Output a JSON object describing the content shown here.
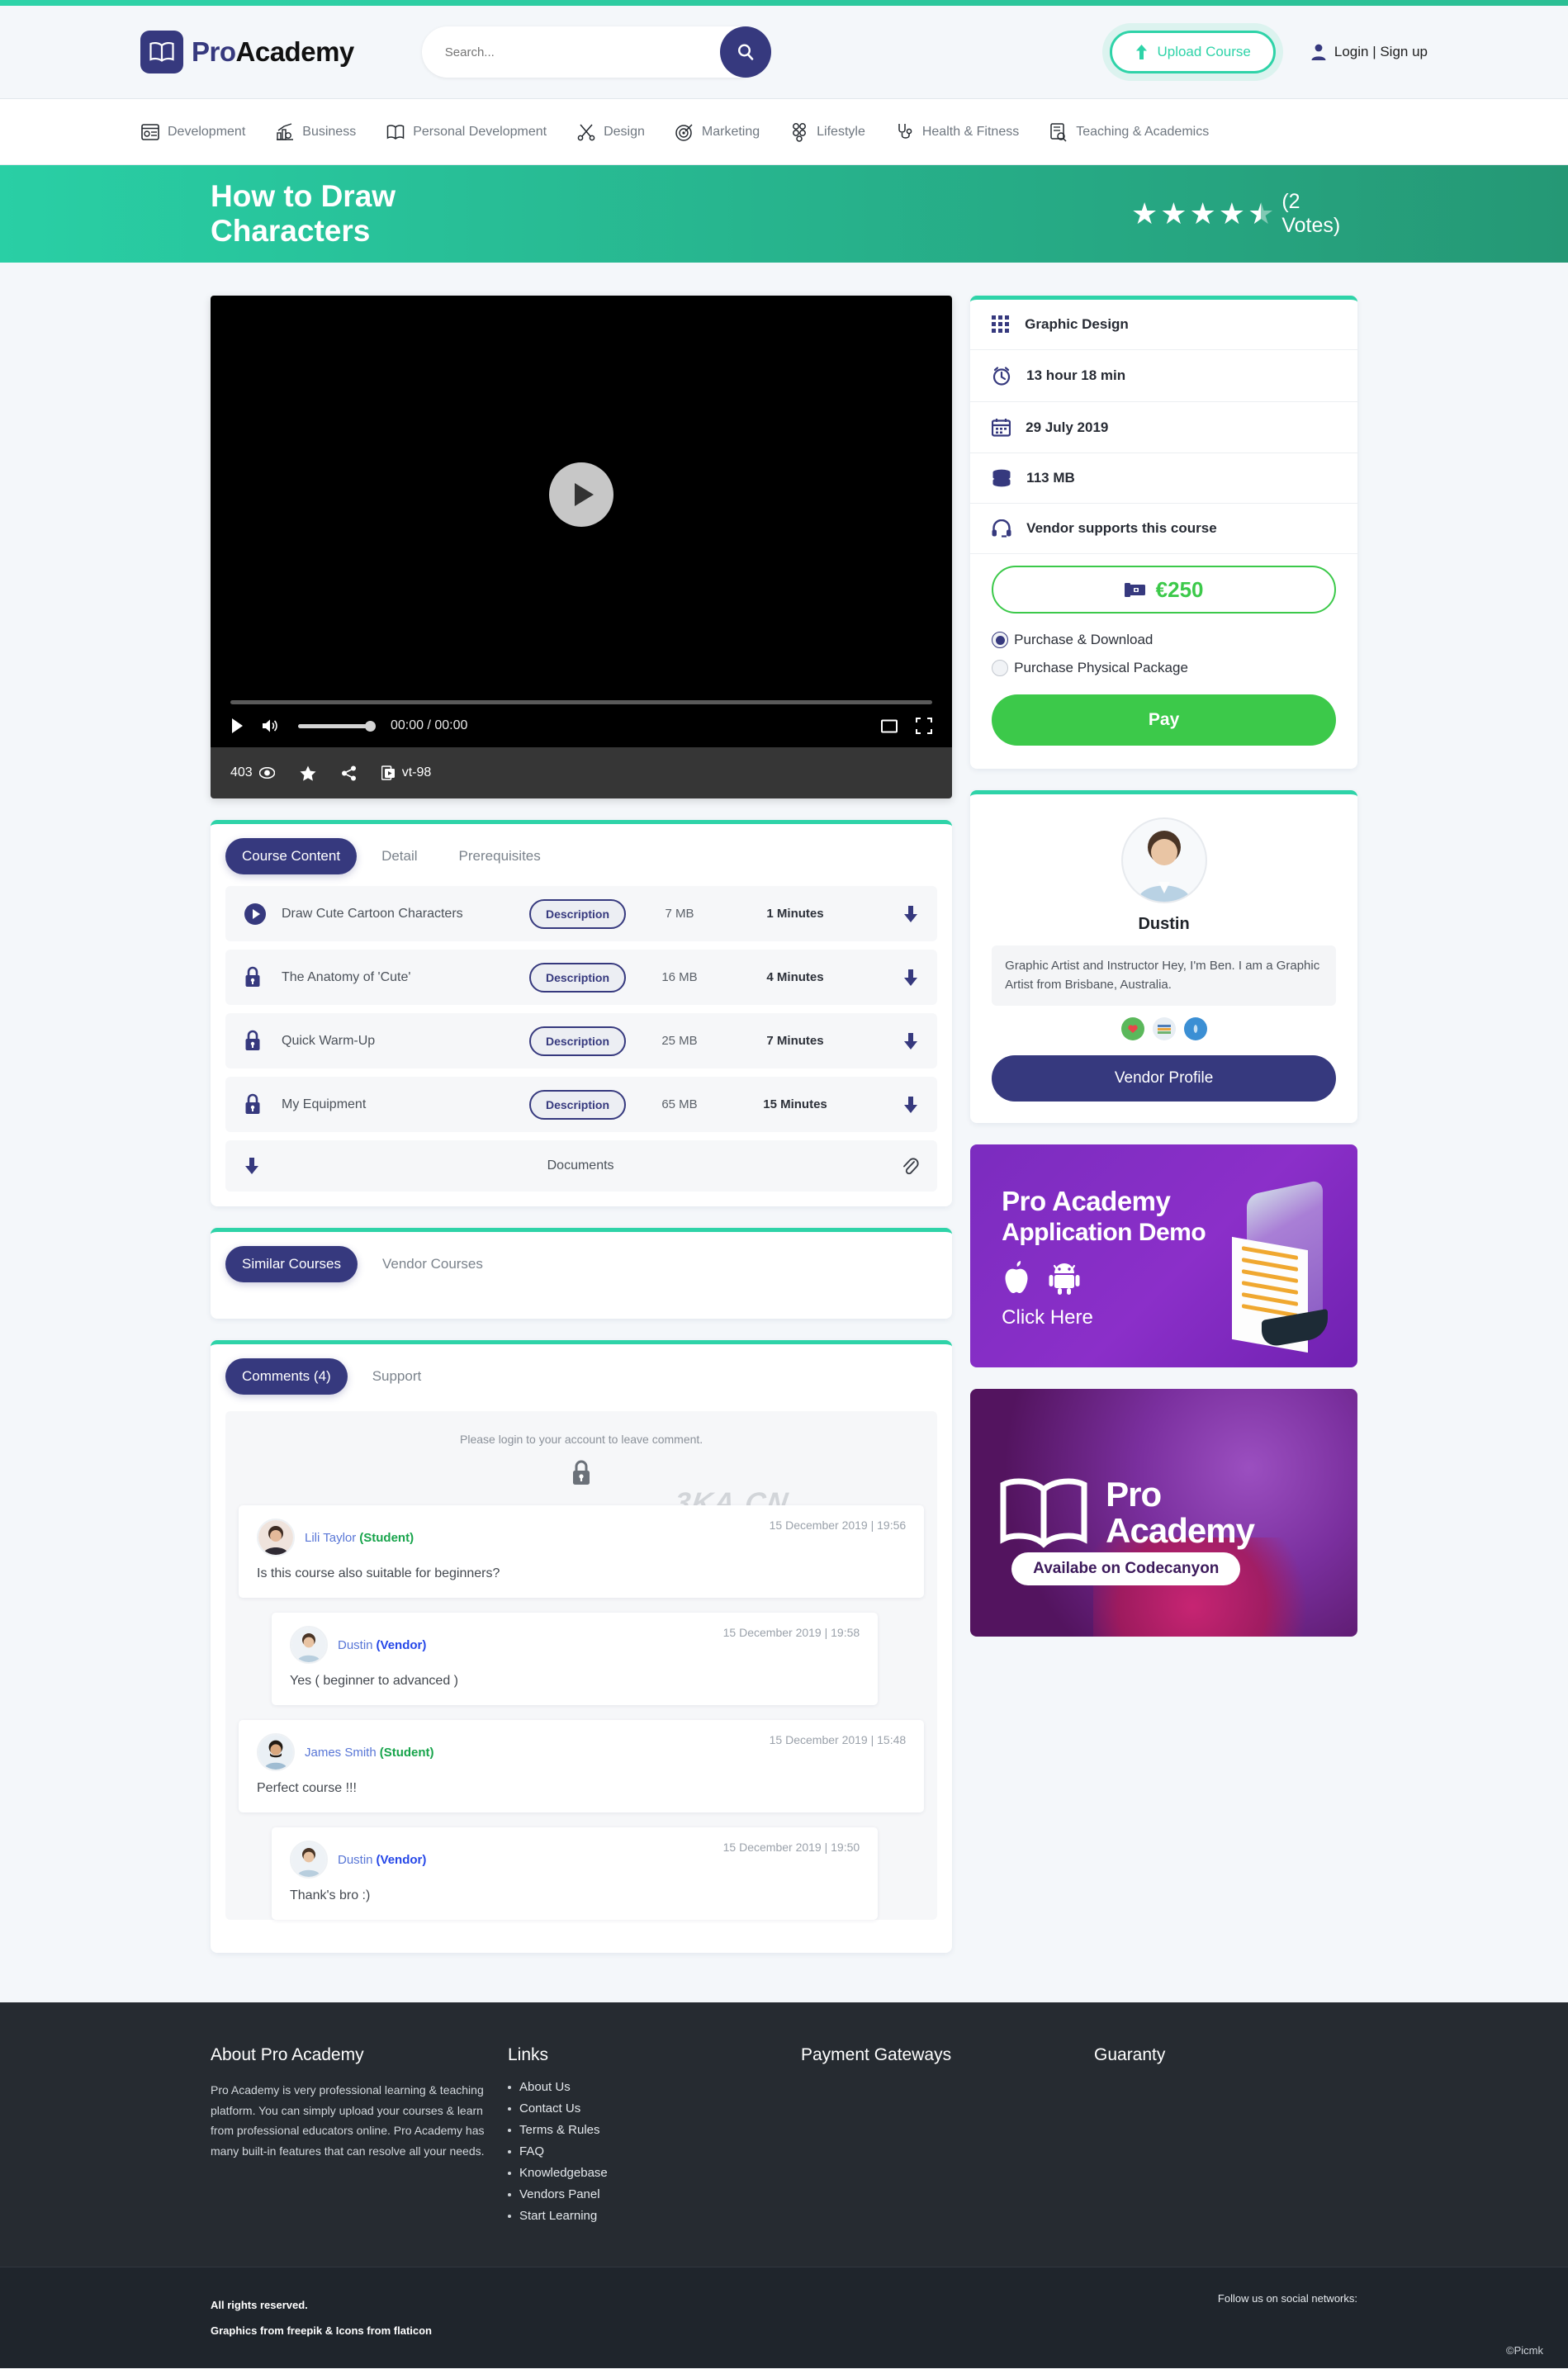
{
  "header": {
    "logo_pro": "Pro",
    "logo_academy": "Academy",
    "search_placeholder": "Search...",
    "search_value": "",
    "upload_label": "Upload Course",
    "login_label": "Login | Sign up"
  },
  "categories": [
    {
      "label": "Development",
      "icon": "development-icon"
    },
    {
      "label": "Business",
      "icon": "business-icon"
    },
    {
      "label": "Personal Development",
      "icon": "personal-development-icon"
    },
    {
      "label": "Design",
      "icon": "design-icon"
    },
    {
      "label": "Marketing",
      "icon": "marketing-icon"
    },
    {
      "label": "Lifestyle",
      "icon": "lifestyle-icon"
    },
    {
      "label": "Health & Fitness",
      "icon": "health-fitness-icon"
    },
    {
      "label": "Teaching & Academics",
      "icon": "teaching-academics-icon"
    }
  ],
  "hero": {
    "title": "How to Draw Characters",
    "rating": 4.5,
    "stars_full": 4,
    "votes_label": "(2 Votes)",
    "gradient_from": "#29cfa5",
    "gradient_to": "#259875"
  },
  "video": {
    "time": "00:00 / 00:00",
    "views": "403",
    "video_id": "vt-98"
  },
  "content_tabs": [
    {
      "label": "Course Content",
      "active": true
    },
    {
      "label": "Detail",
      "active": false
    },
    {
      "label": "Prerequisites",
      "active": false
    }
  ],
  "lessons": [
    {
      "title": "Draw Cute Cartoon Characters",
      "locked": false,
      "desc_label": "Description",
      "size": "7 MB",
      "duration": "1 Minutes"
    },
    {
      "title": "The Anatomy of 'Cute'",
      "locked": true,
      "desc_label": "Description",
      "size": "16 MB",
      "duration": "4 Minutes"
    },
    {
      "title": "Quick Warm-Up",
      "locked": true,
      "desc_label": "Description",
      "size": "25 MB",
      "duration": "7 Minutes"
    },
    {
      "title": "My Equipment",
      "locked": true,
      "desc_label": "Description",
      "size": "65 MB",
      "duration": "15 Minutes"
    }
  ],
  "documents_label": "Documents",
  "course_info": [
    {
      "icon": "grid-icon",
      "text": "Graphic Design"
    },
    {
      "icon": "clock-icon",
      "text": "13 hour 18 min"
    },
    {
      "icon": "calendar-icon",
      "text": "29 July 2019"
    },
    {
      "icon": "database-icon",
      "text": "113 MB"
    },
    {
      "icon": "headset-icon",
      "text": "Vendor supports this course"
    }
  ],
  "purchase": {
    "price": "€250",
    "options": [
      {
        "label": "Purchase & Download",
        "selected": true
      },
      {
        "label": "Purchase Physical Package",
        "selected": false
      }
    ],
    "pay_label": "Pay",
    "price_color": "#3cc94a"
  },
  "vendor": {
    "name": "Dustin",
    "bio": "Graphic Artist and Instructor Hey, I'm Ben. I am a Graphic Artist from Brisbane, Australia.",
    "button_label": "Vendor Profile"
  },
  "similar_tabs": [
    {
      "label": "Similar Courses",
      "active": true
    },
    {
      "label": "Vendor Courses",
      "active": false
    }
  ],
  "comment_tabs": [
    {
      "label": "Comments (4)",
      "active": true
    },
    {
      "label": "Support",
      "active": false
    }
  ],
  "comments_notice": "Please login to your account to leave comment.",
  "watermark": "3KA.CN",
  "comments": [
    {
      "name": "Lili Taylor",
      "role": "(Student)",
      "role_type": "student",
      "date": "15 December 2019 | 19:56",
      "text": "Is this course also suitable for beginners?",
      "reply": false
    },
    {
      "name": "Dustin",
      "role": "(Vendor)",
      "role_type": "vendor",
      "date": "15 December 2019 | 19:58",
      "text": "Yes ( beginner to advanced )",
      "reply": true
    },
    {
      "name": "James Smith",
      "role": "(Student)",
      "role_type": "student",
      "date": "15 December 2019 | 15:48",
      "text": "Perfect course !!!",
      "reply": false
    },
    {
      "name": "Dustin",
      "role": "(Vendor)",
      "role_type": "vendor",
      "date": "15 December 2019 | 19:50",
      "text": "Thank's bro :)",
      "reply": true
    }
  ],
  "banner_app": {
    "line1": "Pro Academy",
    "line2": "Application Demo",
    "cta": "Click Here"
  },
  "banner_codecanyon": {
    "line1": "Pro",
    "line2": "Academy",
    "pill": "Availabe on Codecanyon"
  },
  "footer": {
    "about_title": "About Pro Academy",
    "about_text": "Pro Academy is very professional learning & teaching platform. You can simply upload your courses & learn from professional educators online. Pro Academy has many built-in features that can resolve all your needs.",
    "links_title": "Links",
    "links": [
      "About Us",
      "Contact Us",
      "Terms & Rules",
      "FAQ",
      "Knowledgebase",
      "Vendors Panel",
      "Start Learning"
    ],
    "payment_title": "Payment Gateways",
    "guaranty_title": "Guaranty",
    "rights": "All rights reserved.",
    "credits": "Graphics from freepik & Icons from flaticon",
    "follow": "Follow us on social networks:",
    "picmk": "©Picmk"
  }
}
